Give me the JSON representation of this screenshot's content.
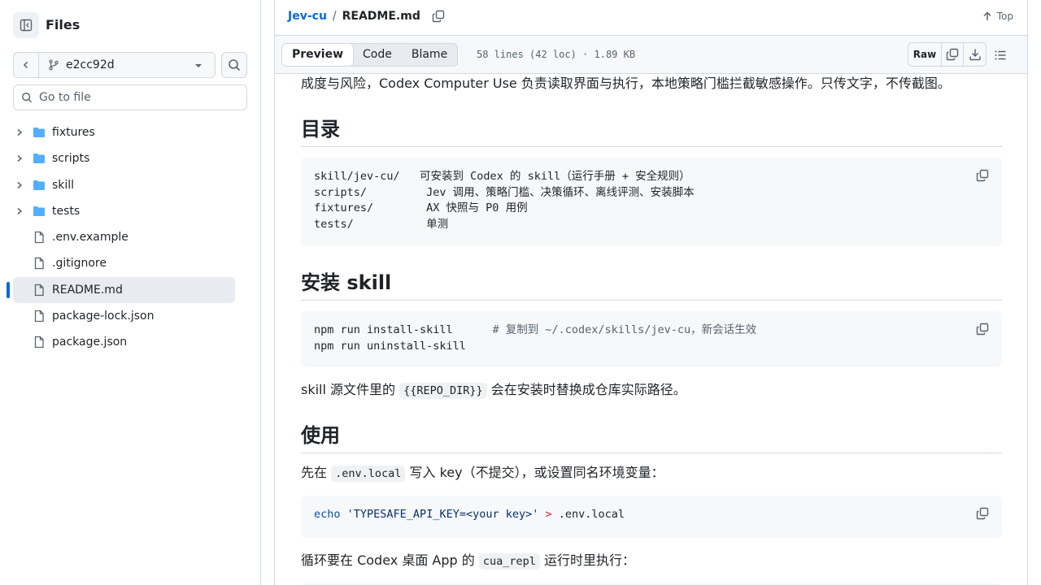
{
  "sidebar": {
    "title": "Files",
    "branch": "e2cc92d",
    "goto_placeholder": "Go to file",
    "items": [
      {
        "label": "fixtures",
        "type": "folder"
      },
      {
        "label": "scripts",
        "type": "folder"
      },
      {
        "label": "skill",
        "type": "folder"
      },
      {
        "label": "tests",
        "type": "folder"
      },
      {
        "label": ".env.example",
        "type": "file"
      },
      {
        "label": ".gitignore",
        "type": "file"
      },
      {
        "label": "README.md",
        "type": "file",
        "selected": true
      },
      {
        "label": "package-lock.json",
        "type": "file"
      },
      {
        "label": "package.json",
        "type": "file"
      }
    ]
  },
  "header": {
    "repo": "Jev-cu",
    "separator": "/",
    "file": "README.md",
    "top_label": "Top"
  },
  "toolbar": {
    "tabs": [
      "Preview",
      "Code",
      "Blame"
    ],
    "active_tab": "Preview",
    "meta": "58 lines (42 loc) · 1.89 KB",
    "raw_label": "Raw"
  },
  "readme": {
    "intro_tail": "成度与风险，Codex Computer Use 负责读取界面与执行，本地策略门槛拦截敏感操作。只传文字，不传截图。",
    "h_toc": "目录",
    "toc_code": [
      "skill/jev-cu/   可安装到 Codex 的 skill（运行手册 + 安全规则）",
      "scripts/         Jev 调用、策略门槛、决策循环、离线评测、安装脚本",
      "fixtures/        AX 快照与 P0 用例",
      "tests/           单测"
    ],
    "h_install": "安装 skill",
    "install_cmd1": "npm run install-skill",
    "install_cmt1": "# 复制到 ~/.codex/skills/jev-cu，新会话生效",
    "install_cmd2": "npm run uninstall-skill",
    "repo_dir_pre": "skill 源文件里的",
    "repo_dir_code": "{{REPO_DIR}}",
    "repo_dir_post": "会在安装时替换成仓库实际路径。",
    "h_usage": "使用",
    "usage_pre": "先在",
    "usage_code": ".env.local",
    "usage_post": "写入 key（不提交），或设置同名环境变量：",
    "echo_kw": "echo",
    "echo_str": "'TYPESAFE_API_KEY=<your key>'",
    "echo_op": ">",
    "echo_file": ".env.local",
    "loop_pre": "循环要在 Codex 桌面 App 的",
    "loop_code": "cua_repl",
    "loop_post": "运行时里执行："
  }
}
